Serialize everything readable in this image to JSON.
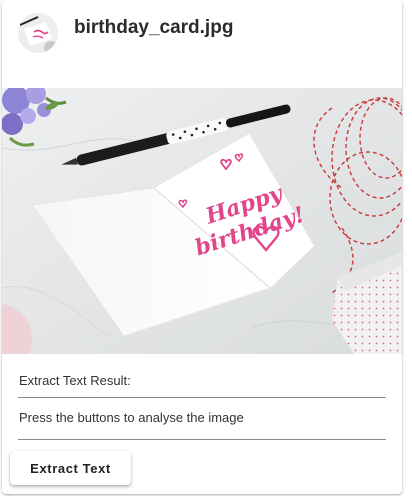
{
  "card": {
    "filename": "birthday_card.jpg",
    "image": {
      "card_text_line1": "Happy",
      "card_text_line2": "birthday!",
      "ink_color": "#e2458b"
    },
    "result_label": "Extract Text Result:",
    "result_text": "Press the buttons to analyse the image",
    "extract_button_label": "Extract Text"
  }
}
